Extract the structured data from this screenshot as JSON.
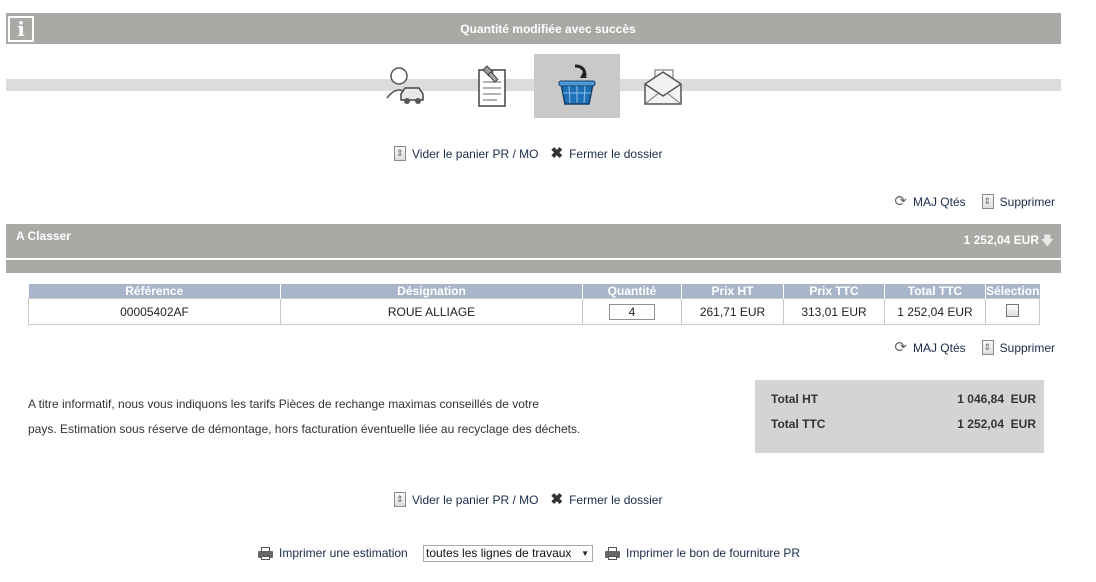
{
  "info_bar": {
    "message": "Quantité modifiée avec succès",
    "icon": "info-icon"
  },
  "steps": [
    {
      "icon": "client-vehicle-icon",
      "active": false
    },
    {
      "icon": "repair-document-icon",
      "active": false
    },
    {
      "icon": "basket-icon",
      "active": true
    },
    {
      "icon": "envelope-icon",
      "active": false
    }
  ],
  "actions_top": {
    "empty_cart": "Vider le panier PR / MO",
    "close_file": "Fermer le dossier"
  },
  "table_actions": {
    "update_qty": "MAJ Qtés",
    "delete": "Supprimer"
  },
  "section": {
    "title": "A Classer",
    "total": "1 252,04 EUR"
  },
  "table": {
    "columns": [
      "Référence",
      "Désignation",
      "Quantité",
      "Prix HT",
      "Prix TTC",
      "Total TTC",
      "Sélection"
    ],
    "rows": [
      {
        "reference": "00005402AF",
        "designation": "ROUE ALLIAGE",
        "quantity": "4",
        "price_ht": "261,71 EUR",
        "price_ttc": "313,01 EUR",
        "total_ttc": "1 252,04 EUR",
        "selected": false
      }
    ]
  },
  "note": {
    "line1": "A titre informatif, nous vous indiquons les tarifs Pièces de rechange maximas conseillés de votre",
    "line2": "pays. Estimation sous réserve de démontage, hors facturation éventuelle liée au recyclage des déchets."
  },
  "totals": {
    "ht_label": "Total HT",
    "ht_value": "1 046,84  EUR",
    "ttc_label": "Total TTC",
    "ttc_value": "1 252,04  EUR"
  },
  "print": {
    "estimate_label": "Imprimer une estimation",
    "scope_selected": "toutes les lignes de travaux",
    "supply_label": "Imprimer le bon de fourniture PR"
  },
  "colors": {
    "bar_gray": "#a8aaa6",
    "table_header": "#a9b6c9",
    "totals_bg": "#d4d4d4",
    "link": "#1a2a4a",
    "basket_blue": "#1f6fb5"
  }
}
